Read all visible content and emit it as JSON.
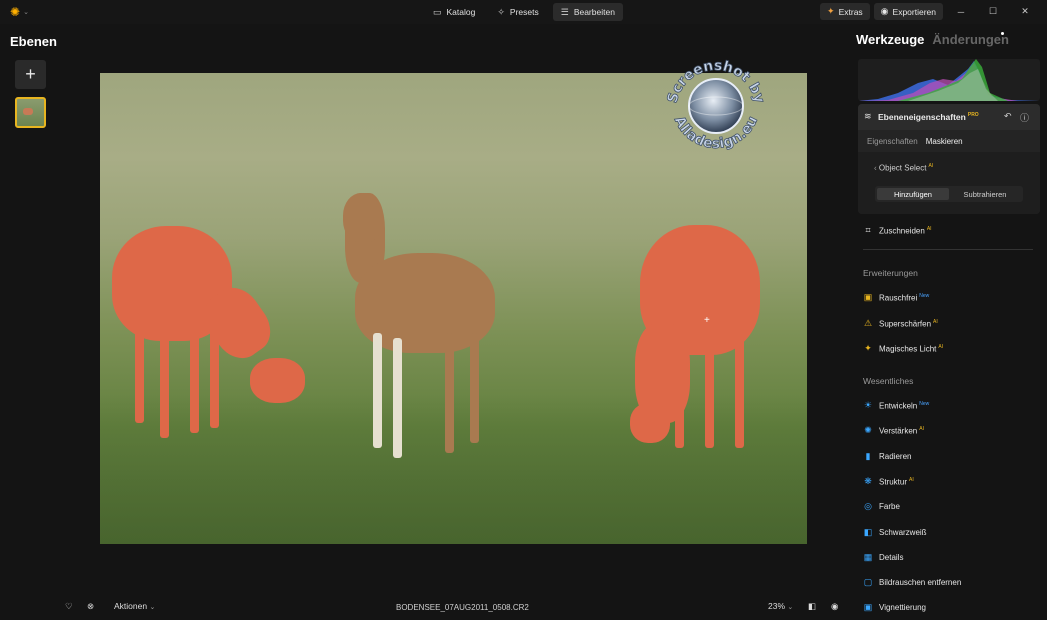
{
  "topbar": {
    "tabs": [
      {
        "label": "Katalog",
        "icon": "folder-icon",
        "active": false
      },
      {
        "label": "Presets",
        "icon": "sparkle-icon",
        "active": false
      },
      {
        "label": "Bearbeiten",
        "icon": "sliders-icon",
        "active": true
      }
    ],
    "extras_label": "Extras",
    "export_label": "Exportieren"
  },
  "left_panel": {
    "title": "Ebenen",
    "add_label": "+"
  },
  "right_panel": {
    "tab_active": "Werkzeuge",
    "tab_inactive": "Änderungen",
    "layer_props": {
      "title": "Ebeneneigenschaften",
      "badge": "PRO",
      "tabs": [
        "Eigenschaften",
        "Maskieren"
      ],
      "active_tab": "Maskieren",
      "object_select": "Object Select",
      "object_select_badge": "AI",
      "mode_add": "Hinzufügen",
      "mode_subtract": "Subtrahieren"
    },
    "crop": {
      "label": "Zuschneiden",
      "badge": "AI"
    },
    "sections": {
      "extensions": "Erweiterungen",
      "essentials": "Wesentliches"
    },
    "extensions": [
      {
        "label": "Rauschfrei",
        "badge": "New",
        "icon": "noise-icon"
      },
      {
        "label": "Superschärfen",
        "badge": "AI",
        "icon": "warning-icon"
      },
      {
        "label": "Magisches Licht",
        "badge": "AI",
        "icon": "magic-light-icon"
      }
    ],
    "essentials": [
      {
        "label": "Entwickeln",
        "badge": "New",
        "icon": "sun-icon"
      },
      {
        "label": "Verstärken",
        "badge": "AI",
        "icon": "enhance-icon"
      },
      {
        "label": "Radieren",
        "badge": "",
        "icon": "eraser-icon"
      },
      {
        "label": "Struktur",
        "badge": "AI",
        "icon": "structure-icon"
      },
      {
        "label": "Farbe",
        "badge": "",
        "icon": "color-icon"
      },
      {
        "label": "Schwarzweiß",
        "badge": "",
        "icon": "bw-icon"
      },
      {
        "label": "Details",
        "badge": "",
        "icon": "details-icon"
      },
      {
        "label": "Bildrauschen entfernen",
        "badge": "",
        "icon": "denoise-icon"
      },
      {
        "label": "Vignettierung",
        "badge": "",
        "icon": "vignette-icon"
      }
    ]
  },
  "bottombar": {
    "actions_label": "Aktionen",
    "filename": "BODENSEE_07AUG2011_0508.CR2",
    "zoom": "23%"
  },
  "watermark": {
    "text_top": "Screenshot by",
    "text_bottom": "Alladesign.eu"
  },
  "colors": {
    "accent": "#e8b520",
    "mask_red": "#de6848",
    "new_badge": "#4aa3ff"
  }
}
